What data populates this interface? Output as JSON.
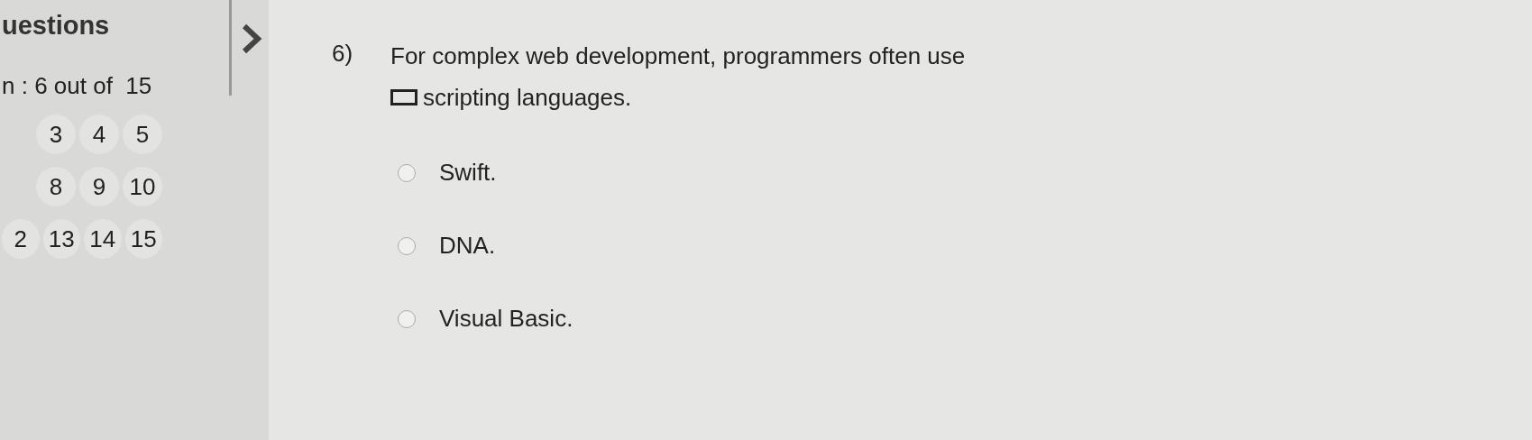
{
  "sidebar": {
    "title": "uestions",
    "progress": "n : 6 out of  15",
    "question_rows": [
      {
        "numbers": [
          "3",
          "4",
          "5"
        ]
      },
      {
        "numbers": [
          "8",
          "9",
          "10"
        ]
      },
      {
        "numbers": [
          "2",
          "13",
          "14",
          "15"
        ]
      }
    ]
  },
  "question": {
    "number": "6)",
    "text_before": "For complex web development, programmers often use",
    "text_after": "scripting languages.",
    "options": [
      {
        "label": "Swift.",
        "selected": false
      },
      {
        "label": "DNA.",
        "selected": false
      },
      {
        "label": "Visual Basic.",
        "selected": false
      }
    ]
  }
}
